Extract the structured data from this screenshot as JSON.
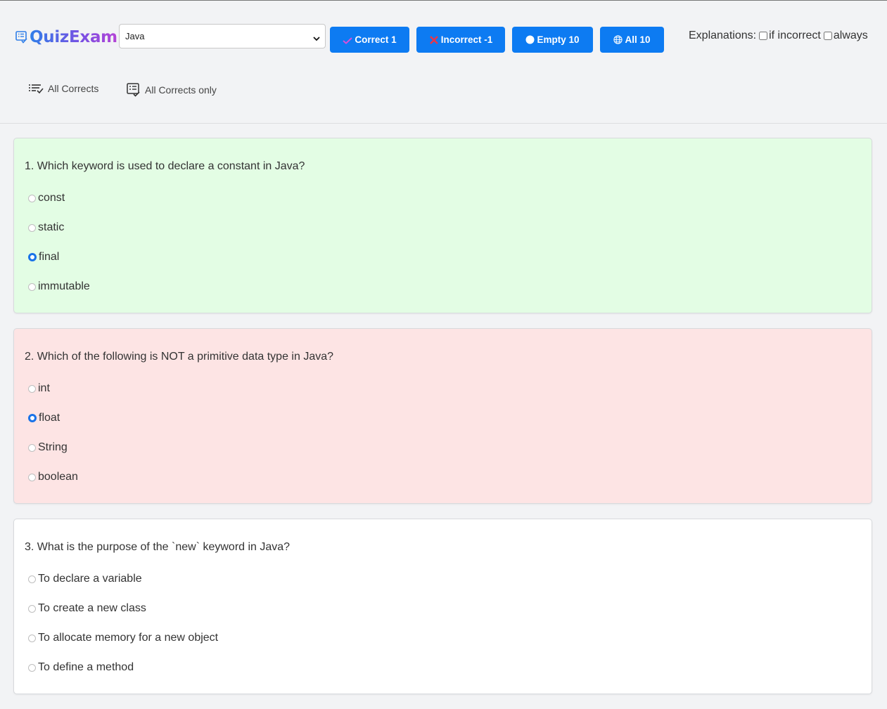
{
  "app": {
    "title": "QuizExam"
  },
  "subject_select": {
    "value": "Java",
    "options": [
      "Java"
    ]
  },
  "filters": {
    "correct": "Correct 1",
    "incorrect": "Incorrect -1",
    "empty": "Empty 10",
    "all": "All 10"
  },
  "explanations": {
    "label": "Explanations:",
    "if_incorrect": "if incorrect",
    "always": "always"
  },
  "links": {
    "all_corrects": "All Corrects",
    "all_corrects_only": "All Corrects only"
  },
  "colors": {
    "accent": "#0d7bf2",
    "correct_bg": "#e3fde4",
    "incorrect_bg": "#fde4e4",
    "neutral_bg": "#ffffff",
    "check_mark": "#d94fd9",
    "cross_mark": "#e8364a"
  },
  "icons": {
    "logo": "quiz-list-icon",
    "correct": "checkmark-icon",
    "incorrect": "cross-icon",
    "empty": "circle-icon",
    "all": "globe-icon",
    "all_corrects": "checklist-icon",
    "all_corrects_only": "checklist-box-icon"
  },
  "questions": [
    {
      "text": "1. Which keyword is used to declare a constant in Java?",
      "status": "correct",
      "options": [
        "const",
        "static",
        "final",
        "immutable"
      ],
      "selected": 2
    },
    {
      "text": "2. Which of the following is NOT a primitive data type in Java?",
      "status": "incorrect",
      "options": [
        "int",
        "float",
        "String",
        "boolean"
      ],
      "selected": 1
    },
    {
      "text": "3. What is the purpose of the `new` keyword in Java?",
      "status": "empty",
      "options": [
        "To declare a variable",
        "To create a new class",
        "To allocate memory for a new object",
        "To define a method"
      ],
      "selected": null
    }
  ]
}
